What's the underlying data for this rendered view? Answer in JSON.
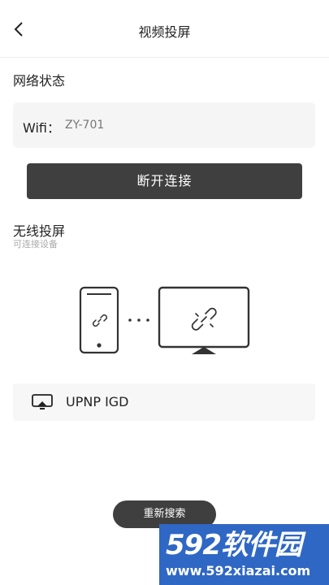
{
  "header": {
    "title": "视频投屏"
  },
  "network": {
    "section_title": "网络状态",
    "wifi_label": "Wifi：",
    "wifi_value": "ZY-701"
  },
  "actions": {
    "disconnect_label": "断开连接",
    "rescan_label": "重新搜索"
  },
  "wireless": {
    "section_title": "无线投屏",
    "subtitle": "可连接设备"
  },
  "devices": [
    {
      "name": "UPNP IGD",
      "icon": "cast-screen-icon"
    }
  ],
  "watermark": {
    "brand": "592软件园",
    "url": "www.592xiazai.com"
  },
  "colors": {
    "button_bg": "#3f3f3f",
    "card_bg": "#f5f5f5",
    "watermark_bg": "#2f67c4"
  }
}
